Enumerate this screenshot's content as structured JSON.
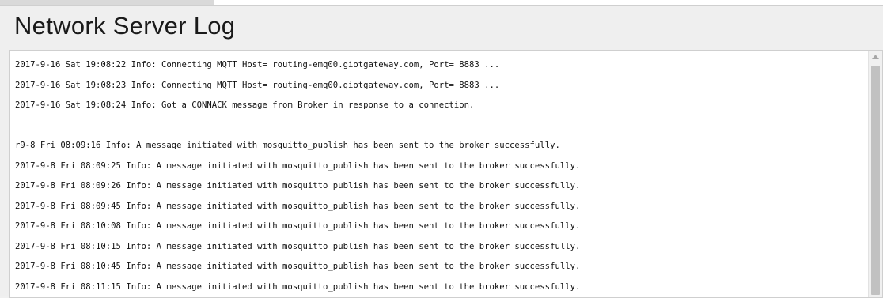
{
  "window": {
    "title": "Network Server Log"
  },
  "log": {
    "lines": [
      "2017-9-16 Sat 19:08:22 Info: Connecting MQTT Host= routing-emq00.giotgateway.com, Port= 8883 ...",
      "2017-9-16 Sat 19:08:23 Info: Connecting MQTT Host= routing-emq00.giotgateway.com, Port= 8883 ...",
      "2017-9-16 Sat 19:08:24 Info: Got a CONNACK message from Broker in response to a connection.",
      "",
      "r9-8 Fri 08:09:16 Info: A message initiated with mosquitto_publish has been sent to the broker successfully.",
      "2017-9-8 Fri 08:09:25 Info: A message initiated with mosquitto_publish has been sent to the broker successfully.",
      "2017-9-8 Fri 08:09:26 Info: A message initiated with mosquitto_publish has been sent to the broker successfully.",
      "2017-9-8 Fri 08:09:45 Info: A message initiated with mosquitto_publish has been sent to the broker successfully.",
      "2017-9-8 Fri 08:10:08 Info: A message initiated with mosquitto_publish has been sent to the broker successfully.",
      "2017-9-8 Fri 08:10:15 Info: A message initiated with mosquitto_publish has been sent to the broker successfully.",
      "2017-9-8 Fri 08:10:45 Info: A message initiated with mosquitto_publish has been sent to the broker successfully.",
      "2017-9-8 Fri 08:11:15 Info: A message initiated with mosquitto_publish has been sent to the broker successfully."
    ]
  },
  "scrollbar": {
    "up_arrow_icon": "triangle-up-icon"
  }
}
